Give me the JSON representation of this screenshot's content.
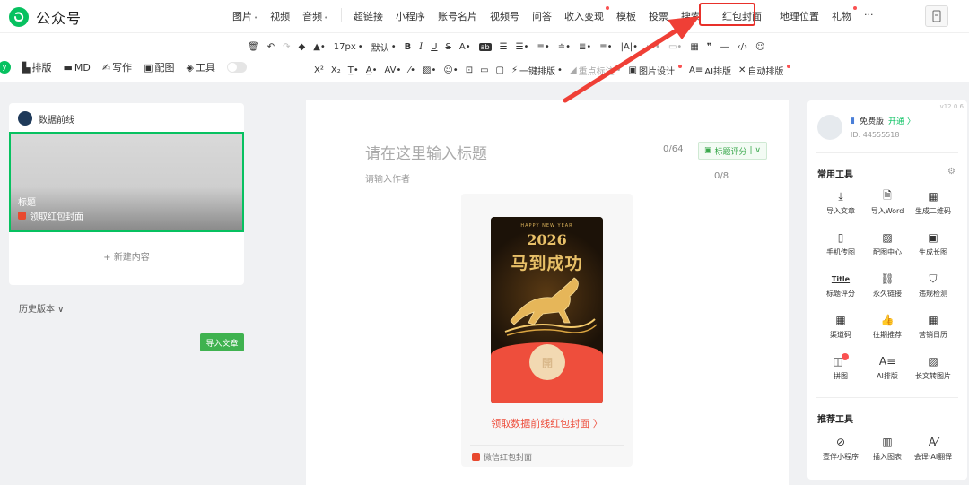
{
  "header": {
    "app_name": "公众号",
    "nav": [
      {
        "label": "图片",
        "caret": true
      },
      {
        "label": "视频"
      },
      {
        "label": "音频",
        "caret": true
      },
      {
        "label": "超链接"
      },
      {
        "label": "小程序"
      },
      {
        "label": "账号名片"
      },
      {
        "label": "视频号"
      },
      {
        "label": "问答"
      },
      {
        "label": "收入变现",
        "dot": true
      },
      {
        "label": "模板"
      },
      {
        "label": "投票"
      },
      {
        "label": "搜索"
      },
      {
        "label": "红包封面",
        "highlighted": true
      },
      {
        "label": "地理位置"
      },
      {
        "label": "礼物",
        "dot": true
      },
      {
        "label": "···"
      }
    ]
  },
  "toolbar": {
    "font_size": "17px",
    "font_default": "默认",
    "one_click_layout": "一键排版",
    "highlight_tool": "重点标注",
    "image_design": "图片设计",
    "ai_layout": "AI排版",
    "auto_layout": "自动排版"
  },
  "left_tools": {
    "items": [
      "排版",
      "MD",
      "写作",
      "配图",
      "工具"
    ]
  },
  "left_panel": {
    "account_name": "数据前线",
    "draft_title": "标题",
    "draft_subtitle": "领取红包封面",
    "new_content": "+ 新建内容",
    "history": "历史版本 ∨",
    "import_button": "导入文章"
  },
  "editor": {
    "title_placeholder": "请在这里输入标题",
    "title_count": "0/64",
    "score_button": "标题评分",
    "author_placeholder": "请输入作者",
    "author_count": "0/8",
    "cover": {
      "happy_new_year": "HAPPY NEW YEAR",
      "year": "2026",
      "slogan": "马到成功",
      "seal": "開",
      "link": "领取数据前线红包封面 〉",
      "footer": "微信红包封面"
    }
  },
  "right_panel": {
    "version": "v12.0.6",
    "plan": "免费版",
    "upgrade": "开通 〉",
    "user_id": "ID: 44555518",
    "common_tools_title": "常用工具",
    "common_tools": [
      {
        "label": "导入文章",
        "icon": "import-icon"
      },
      {
        "label": "导入Word",
        "icon": "word-icon"
      },
      {
        "label": "生成二维码",
        "icon": "qrcode-icon"
      },
      {
        "label": "手机传图",
        "icon": "phone-upload-icon"
      },
      {
        "label": "配图中心",
        "icon": "image-center-icon"
      },
      {
        "label": "生成长图",
        "icon": "long-image-icon"
      },
      {
        "label": "标题评分",
        "icon": "title-score-icon"
      },
      {
        "label": "永久链接",
        "icon": "link-icon"
      },
      {
        "label": "违规检测",
        "icon": "shield-check-icon"
      },
      {
        "label": "渠道码",
        "icon": "channel-code-icon"
      },
      {
        "label": "往期推荐",
        "icon": "thumbs-up-icon"
      },
      {
        "label": "营销日历",
        "icon": "calendar-icon"
      },
      {
        "label": "拼图",
        "icon": "puzzle-icon"
      },
      {
        "label": "AI排版",
        "icon": "ai-layout-icon"
      },
      {
        "label": "长文转图片",
        "icon": "text-to-image-icon"
      }
    ],
    "recommend_tools_title": "推荐工具",
    "recommend_tools": [
      {
        "label": "壹伴小程序",
        "icon": "mini-program-icon"
      },
      {
        "label": "插入图表",
        "icon": "chart-insert-icon"
      },
      {
        "label": "会译·AI翻译",
        "icon": "ai-translate-icon"
      }
    ]
  },
  "colors": {
    "brand_green": "#07c160",
    "highlight_red": "#e8302a",
    "cover_red": "#ee4e3c",
    "gold": "#e8c068"
  }
}
